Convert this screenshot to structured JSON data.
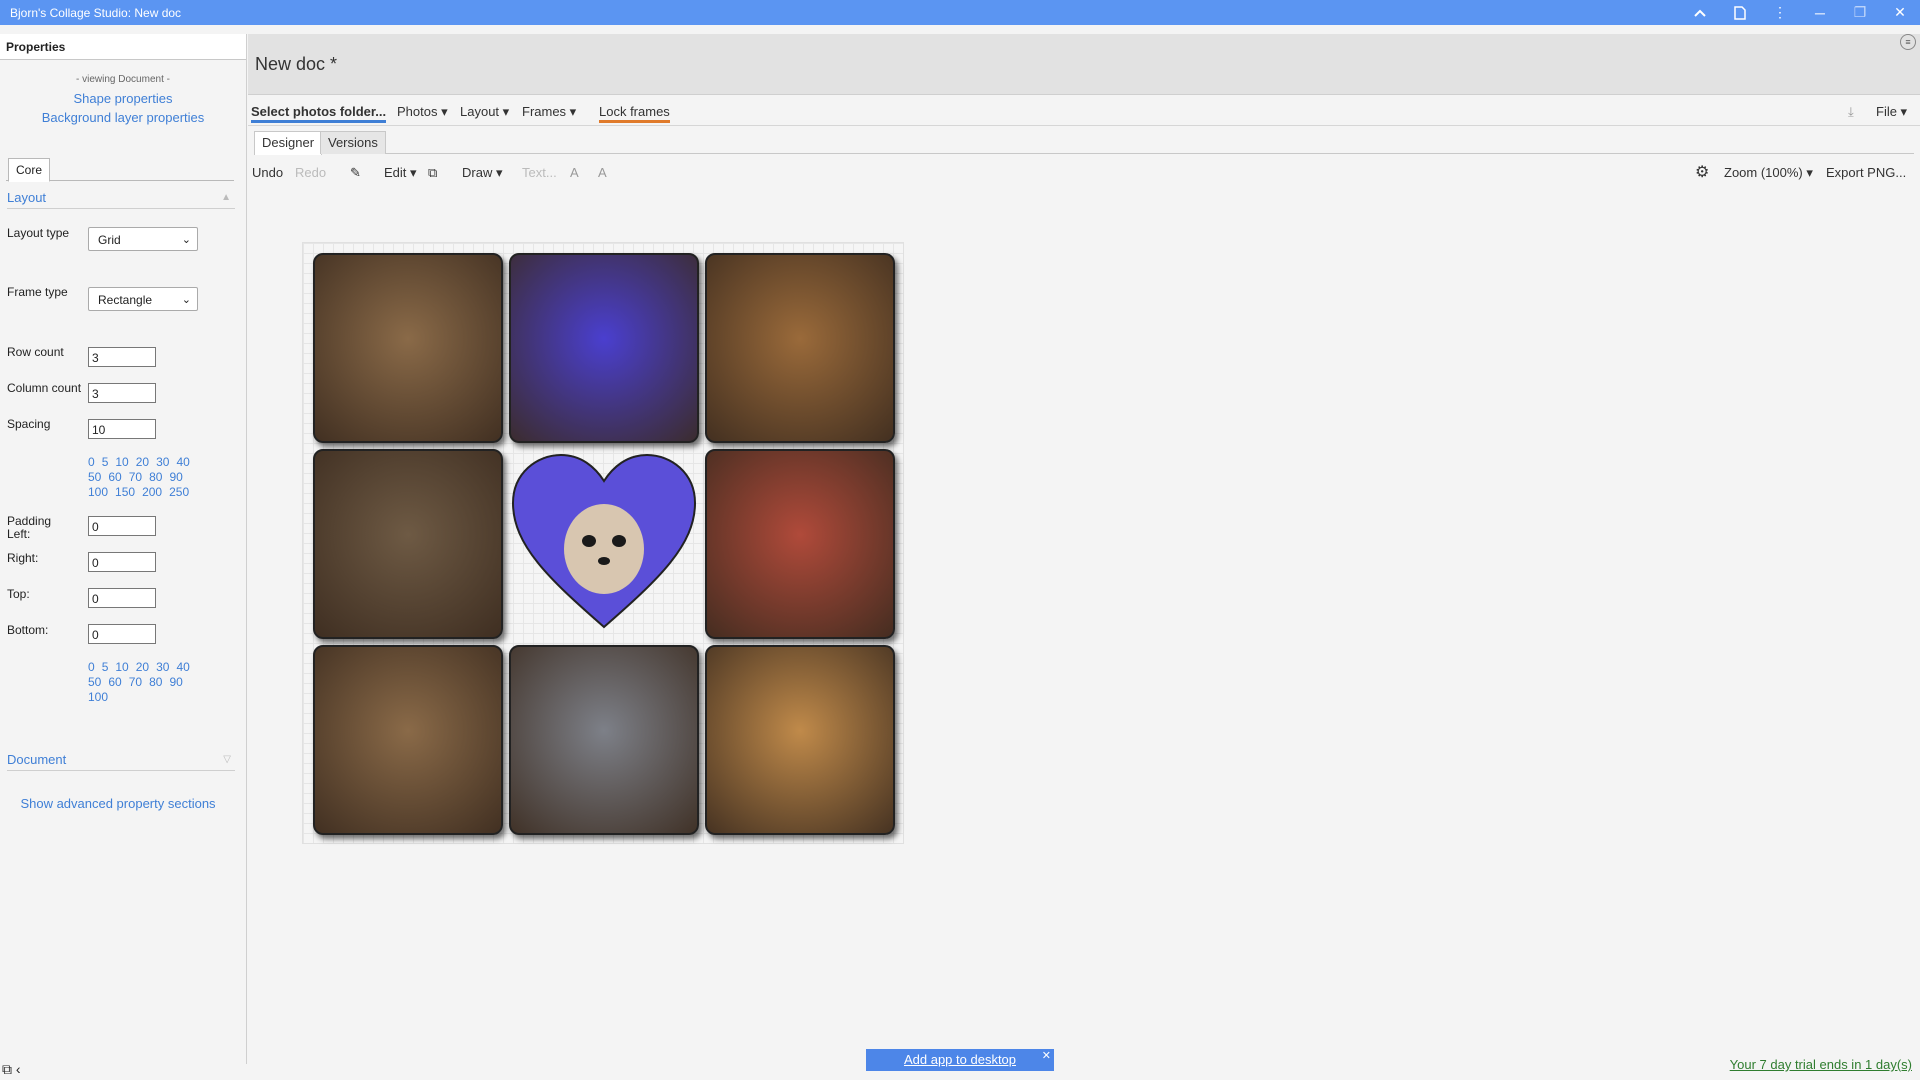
{
  "window": {
    "title": "Bjorn's Collage Studio: New doc",
    "accent": "#5b95f2"
  },
  "sidebar": {
    "header": "Properties",
    "viewing": "- viewing Document -",
    "links": [
      "Shape properties",
      "Background layer properties"
    ],
    "tab": "Core",
    "layout_section": "Layout",
    "layout_type_label": "Layout type",
    "layout_type_value": "Grid",
    "frame_type_label": "Frame type",
    "frame_type_value": "Rectangle",
    "row_count_label": "Row count",
    "row_count_value": "3",
    "column_count_label": "Column count",
    "column_count_value": "3",
    "spacing_label": "Spacing",
    "spacing_value": "10",
    "spacing_presets": [
      [
        "0",
        "5",
        "10",
        "20",
        "30",
        "40"
      ],
      [
        "50",
        "60",
        "70",
        "80",
        "90"
      ],
      [
        "100",
        "150",
        "200",
        "250"
      ]
    ],
    "padding_left_label": "Padding Left:",
    "padding_left_value": "0",
    "right_label": "Right:",
    "right_value": "0",
    "top_label": "Top:",
    "top_value": "0",
    "bottom_label": "Bottom:",
    "bottom_value": "0",
    "padding_presets": [
      [
        "0",
        "5",
        "10",
        "20",
        "30",
        "40"
      ],
      [
        "50",
        "60",
        "70",
        "80",
        "90"
      ],
      [
        "100"
      ]
    ],
    "document_section": "Document",
    "advanced_link": "Show advanced property sections"
  },
  "main": {
    "doc_title": "New doc *",
    "toolbar1": {
      "select_folder": "Select photos folder...",
      "photos": "Photos ▾",
      "layout": "Layout ▾",
      "frames": "Frames ▾",
      "lock_frames": "Lock frames",
      "file": "File ▾"
    },
    "tabs": [
      "Designer",
      "Versions"
    ],
    "toolbar2": {
      "undo": "Undo",
      "redo": "Redo",
      "edit": "Edit ▾",
      "draw": "Draw ▾",
      "text": "Text...",
      "zoom": "Zoom (100%) ▾",
      "export": "Export PNG..."
    },
    "canvas": {
      "tiles": [
        {
          "name": "dog-photo-terrier",
          "color": "#8a6a48"
        },
        {
          "name": "dog-photo-husky",
          "color": "#4a3fcf"
        },
        {
          "name": "dog-photo-collie",
          "color": "#9a6a3a"
        },
        {
          "name": "dog-photo-black-dog",
          "color": "#6e5a44"
        },
        {
          "name": "dog-photo-pomeranian-heart",
          "color": "#5b4fd8"
        },
        {
          "name": "dog-photo-shaggy",
          "color": "#b04a3a"
        },
        {
          "name": "dog-photo-yorkie",
          "color": "#8a6a48"
        },
        {
          "name": "dog-photo-shepherd-puppy",
          "color": "#7d8088"
        },
        {
          "name": "dog-photo-tan-dog",
          "color": "#c08a4a"
        }
      ]
    }
  },
  "footer": {
    "add_app": "Add app to desktop",
    "trial": "Your 7 day trial ends in 1 day(s)"
  }
}
